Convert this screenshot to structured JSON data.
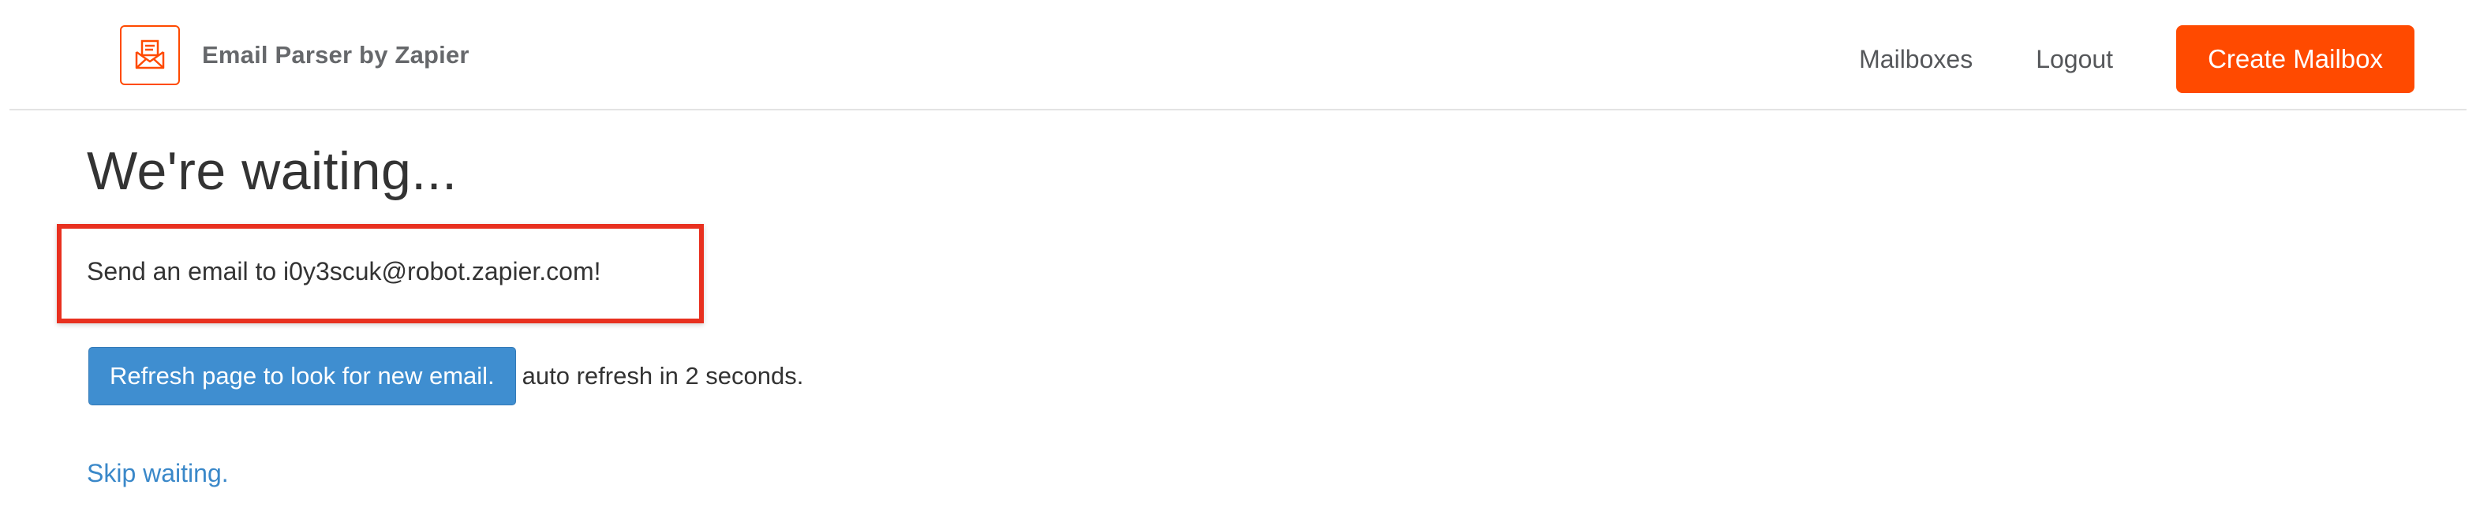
{
  "header": {
    "app_name": "Email Parser by Zapier",
    "logo_icon": "envelope-parser-icon",
    "nav": {
      "mailboxes": "Mailboxes",
      "logout": "Logout",
      "create_mailbox": "Create Mailbox"
    }
  },
  "main": {
    "title": "We're waiting...",
    "instruction": "Send an email to i0y3scuk@robot.zapier.com!",
    "refresh_button": "Refresh page to look for new email.",
    "auto_refresh_text": "auto refresh in 2 seconds.",
    "skip_link": "Skip waiting."
  },
  "colors": {
    "brand_orange": "#ff4a00",
    "button_blue": "#3f8ed0",
    "link_blue": "#3a88c9",
    "highlight_red": "#e8301f"
  }
}
